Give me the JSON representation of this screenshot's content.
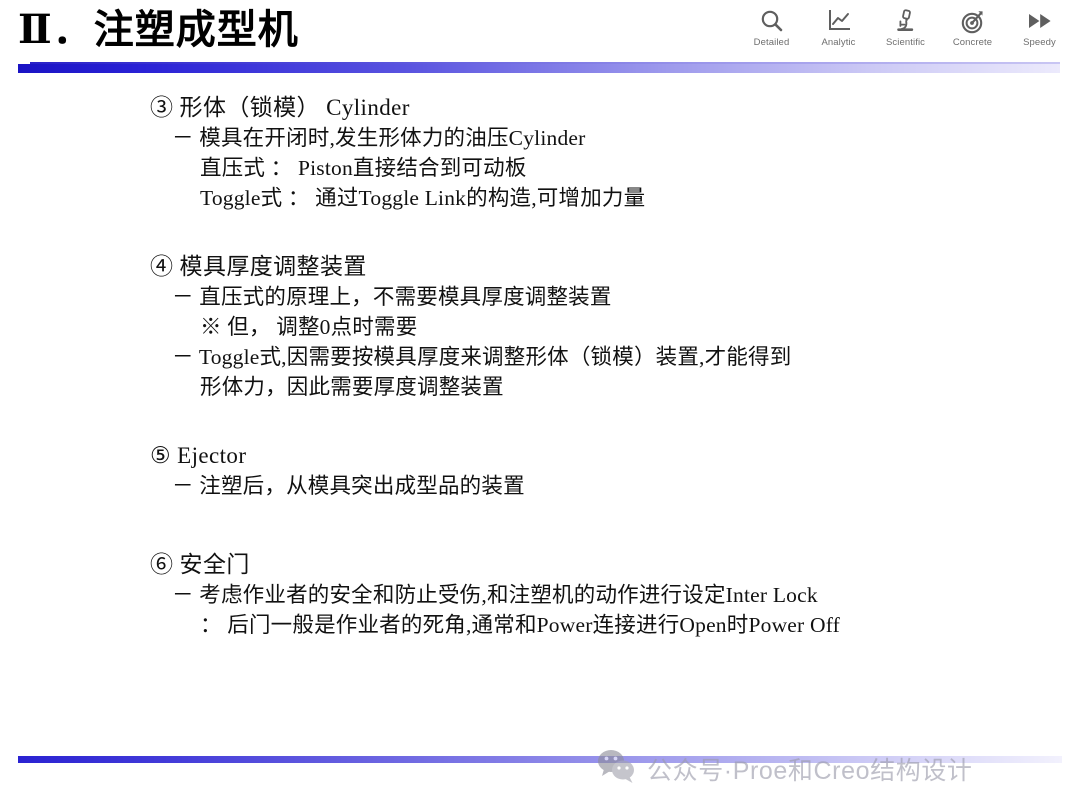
{
  "header": {
    "title": "Ⅱ．注塑成型机",
    "icons": [
      {
        "name": "search-icon",
        "label": "Detailed"
      },
      {
        "name": "line-chart-icon",
        "label": "Analytic"
      },
      {
        "name": "microscope-icon",
        "label": "Scientific"
      },
      {
        "name": "target-icon",
        "label": "Concrete"
      },
      {
        "name": "fast-forward-icon",
        "label": "Speedy"
      }
    ]
  },
  "content": {
    "item3": {
      "heading": "③ 形体（锁模） Cylinder",
      "line1": "－ 模具在开闭时,发生形体力的油压Cylinder",
      "line2": "直压式 ： Piston直接结合到可动板",
      "line3": "Toggle式 ： 通过Toggle Link的构造,可增加力量"
    },
    "item4": {
      "heading": "④ 模具厚度调整装置",
      "line1": "－ 直压式的原理上，不需要模具厚度调整装置",
      "line2": "※ 但， 调整0点时需要",
      "line3": "－ Toggle式,因需要按模具厚度来调整形体（锁模）装置,才能得到",
      "line4": "形体力，因此需要厚度调整装置"
    },
    "item5": {
      "heading": "⑤ Ejector",
      "line1": "－ 注塑后，从模具突出成型品的装置"
    },
    "item6": {
      "heading": "⑥ 安全门",
      "line1": "－ 考虑作业者的安全和防止受伤,和注塑机的动作进行设定Inter Lock",
      "line2": "： 后门一般是作业者的死角,通常和Power连接进行Open时Power Off"
    }
  },
  "footer": {
    "watermark_text": "公众号·Proe和Creo结构设计"
  },
  "colors": {
    "accent_blue": "#2a22d6",
    "accent_fade": "#eceafc",
    "icon_gray": "#6e6e6e",
    "watermark_gray": "#9b9bab",
    "text_black": "#111111",
    "background": "#ffffff"
  }
}
